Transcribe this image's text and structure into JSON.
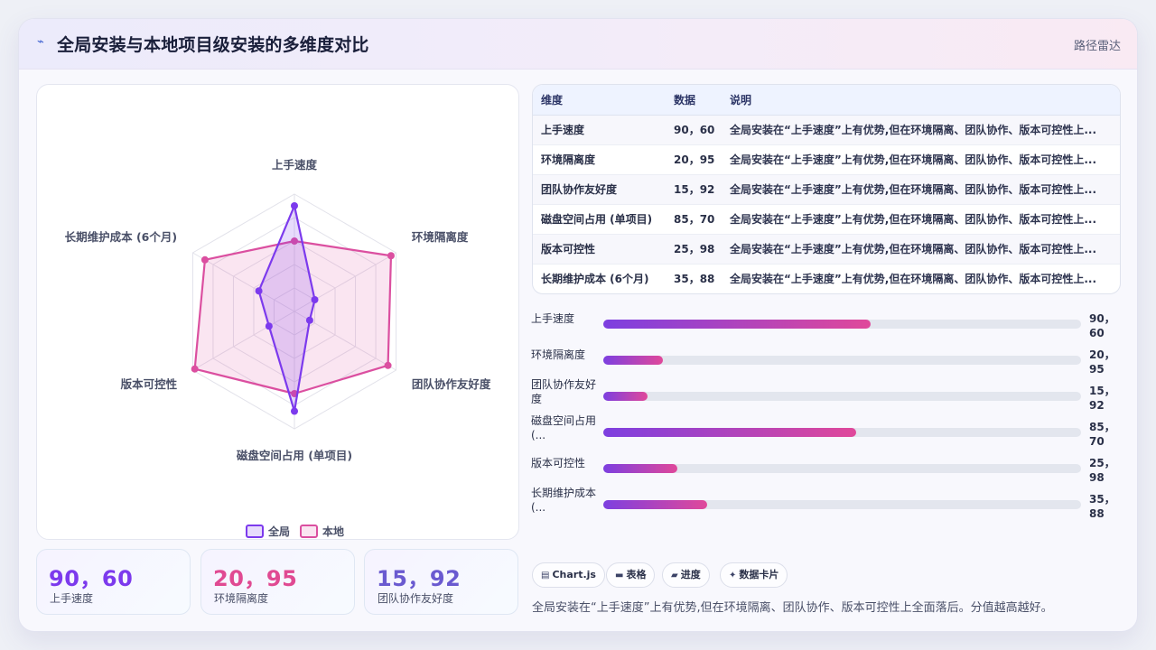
{
  "header": {
    "icon": "trend-icon",
    "title": "全局安装与本地项目级安装的多维度对比",
    "tag": "路径雷达"
  },
  "colors": {
    "global": "#7c3aed",
    "local": "#db4fa0",
    "kpi1": "#7c3aed",
    "kpi2": "#e04a92",
    "kpi3": "#6a5ad0"
  },
  "chart_data": {
    "type": "radar",
    "categories": [
      "上手速度",
      "环境隔离度",
      "团队协作友好度",
      "磁盘空间占用 (单项目)",
      "版本可控性",
      "长期维护成本 (6个月)"
    ],
    "series": [
      {
        "name": "全局",
        "values": [
          90,
          20,
          15,
          85,
          25,
          35
        ]
      },
      {
        "name": "本地",
        "values": [
          60,
          95,
          92,
          70,
          98,
          88
        ]
      }
    ],
    "rlim": [
      0,
      100
    ],
    "rings": 5,
    "legend": "bottom"
  },
  "table": {
    "headers": [
      "维度",
      "数据",
      "说明"
    ],
    "rows": [
      {
        "dim": "上手速度",
        "data": "90，60",
        "desc": "全局安装在“上手速度”上有优势,但在环境隔离、团队协作、版本可控性上..."
      },
      {
        "dim": "环境隔离度",
        "data": "20，95",
        "desc": "全局安装在“上手速度”上有优势,但在环境隔离、团队协作、版本可控性上..."
      },
      {
        "dim": "团队协作友好度",
        "data": "15，92",
        "desc": "全局安装在“上手速度”上有优势,但在环境隔离、团队协作、版本可控性上..."
      },
      {
        "dim": "磁盘空间占用 (单项目)",
        "data": "85，70",
        "desc": "全局安装在“上手速度”上有优势,但在环境隔离、团队协作、版本可控性上..."
      },
      {
        "dim": "版本可控性",
        "data": "25，98",
        "desc": "全局安装在“上手速度”上有优势,但在环境隔离、团队协作、版本可控性上..."
      },
      {
        "dim": "长期维护成本 (6个月)",
        "data": "35，88",
        "desc": "全局安装在“上手速度”上有优势,但在环境隔离、团队协作、版本可控性上..."
      }
    ]
  },
  "bars": [
    {
      "label": "上手速度",
      "value": "90，60",
      "fraction": 0.56
    },
    {
      "label": "环境隔离度",
      "value": "20，95",
      "fraction": 0.125
    },
    {
      "label": "团队协作友好度",
      "value": "15，92",
      "fraction": 0.093
    },
    {
      "label": "磁盘空间占用 (...",
      "value": "85，70",
      "fraction": 0.53
    },
    {
      "label": "版本可控性",
      "value": "25，98",
      "fraction": 0.155
    },
    {
      "label": "长期维护成本 (...",
      "value": "35，88",
      "fraction": 0.218
    }
  ],
  "kpis": [
    {
      "value": "90，60",
      "label": "上手速度"
    },
    {
      "value": "20，95",
      "label": "环境隔离度"
    },
    {
      "value": "15，92",
      "label": "团队协作友好度"
    }
  ],
  "chips": [
    {
      "icon": "chart-icon",
      "label": "Chart.js"
    },
    {
      "icon": "table-icon",
      "label": "表格"
    },
    {
      "icon": "progress-icon",
      "label": "进度"
    },
    {
      "icon": "card-icon",
      "label": "数据卡片"
    }
  ],
  "summary": "全局安装在“上手速度”上有优势,但在环境隔离、团队协作、版本可控性上全面落后。分值越高越好。"
}
